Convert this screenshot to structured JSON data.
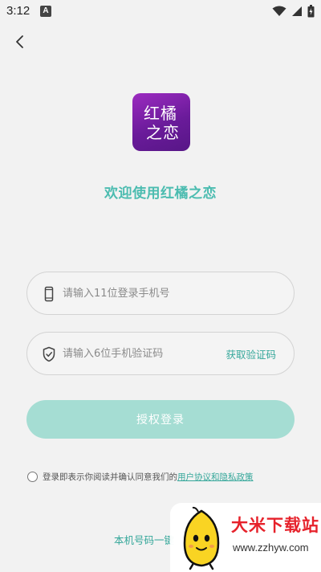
{
  "status_bar": {
    "time": "3:12",
    "notification_badge": "A"
  },
  "app": {
    "logo_line1": "红橘",
    "logo_line2": "之恋",
    "welcome": "欢迎使用红橘之恋"
  },
  "form": {
    "phone_placeholder": "请输入11位登录手机号",
    "code_placeholder": "请输入6位手机验证码",
    "get_code_label": "获取验证码",
    "login_label": "授权登录"
  },
  "agreement": {
    "text": "登录即表示你阅读并确认同意我们的",
    "link": "用户协议和隐私政策",
    "checked": false
  },
  "one_key_login": "本机号码一键",
  "watermark": {
    "title": "大米下载站",
    "url": "www.zzhyw.com"
  },
  "colors": {
    "accent": "#4bbcb0",
    "button_bg": "#a5ddd3",
    "logo_bg": "#6a1b9a",
    "watermark_red": "#e6222b"
  }
}
